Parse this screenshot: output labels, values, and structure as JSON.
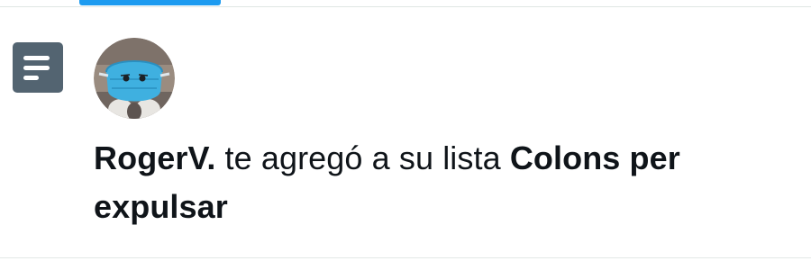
{
  "notification": {
    "icon": "list-icon",
    "avatar": "avatar",
    "user_name": "RogerV.",
    "action_text": " te agregó a su lista ",
    "list_name": "Colons per expulsar"
  },
  "colors": {
    "accent": "#1d9bf0",
    "icon_bg": "#536471",
    "text": "#0f1419",
    "divider": "#dfe6e3"
  }
}
